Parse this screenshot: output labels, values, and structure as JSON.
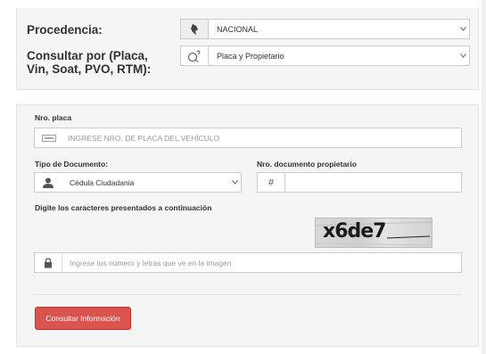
{
  "top": {
    "procedencia_label": "Procedencia:",
    "procedencia_value": "NACIONAL",
    "consultar_label": "Consultar por (Placa, Vin, Soat, PVO, RTM):",
    "consultar_value": "Placa y Propietario"
  },
  "form": {
    "placa_label": "Nro. placa",
    "placa_placeholder": "INGRESE NRO. DE PLACA DEL VEHÍCULO",
    "tipo_doc_label": "Tipo de Documento:",
    "tipo_doc_value": "Cédula Ciudadania",
    "nro_doc_label": "Nro. documento propietario",
    "nro_doc_symbol": "#",
    "captcha_label": "Digite los caracteres presentados a continuación",
    "captcha_text": "x6de7",
    "captcha_placeholder": "Ingrese los número y letras que ve en la imagen",
    "submit_label": "Consultar Información"
  },
  "colors": {
    "button": "#d9534f",
    "panel": "#f5f5f5"
  }
}
